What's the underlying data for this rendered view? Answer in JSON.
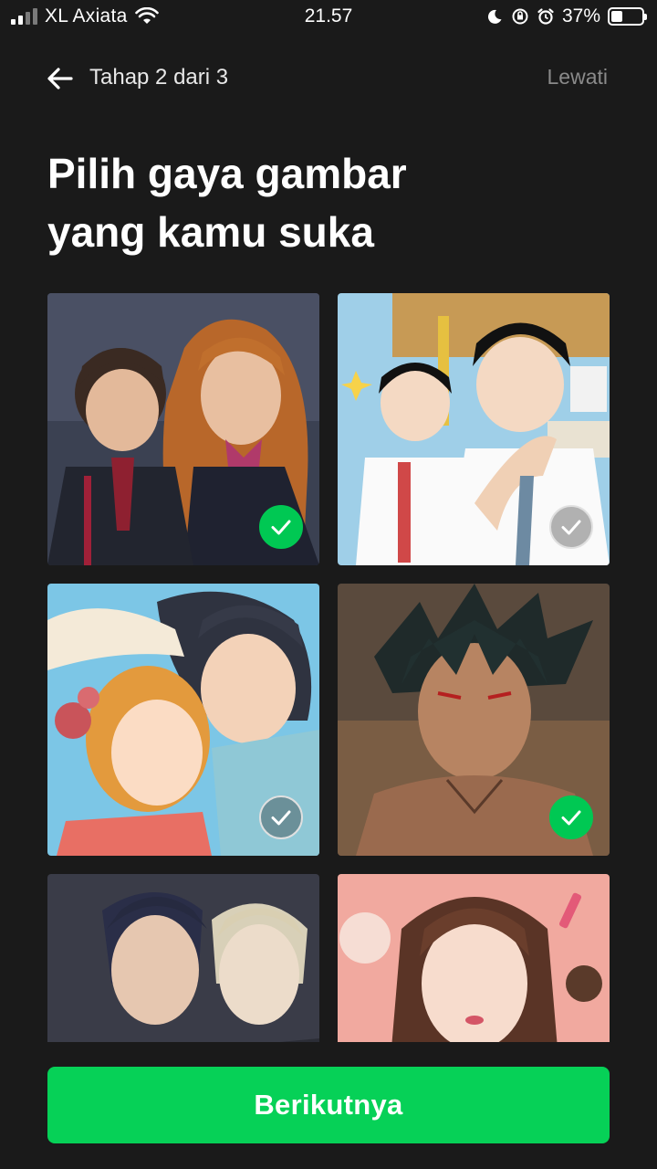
{
  "status_bar": {
    "carrier": "XL Axiata",
    "time": "21.57",
    "battery_percent": "37%",
    "battery_level": 0.37,
    "icons": [
      "signal-icon",
      "wifi-icon",
      "moon-icon",
      "orientation-lock-icon",
      "alarm-icon",
      "battery-icon"
    ]
  },
  "header": {
    "back_icon": "arrow-left-icon",
    "step_label": "Tahap 2 dari 3",
    "skip_label": "Lewati"
  },
  "title_line1": "Pilih gaya gambar",
  "title_line2": "yang kamu suka",
  "styles": [
    {
      "id": "style-1",
      "selected": true
    },
    {
      "id": "style-2",
      "selected": false
    },
    {
      "id": "style-3",
      "selected": false
    },
    {
      "id": "style-4",
      "selected": true
    },
    {
      "id": "style-5",
      "selected": false
    },
    {
      "id": "style-6",
      "selected": false
    }
  ],
  "next_button_label": "Berikutnya",
  "colors": {
    "background": "#1a1a1a",
    "accent_green": "#06d157",
    "skip_text": "#8a8a8a"
  }
}
